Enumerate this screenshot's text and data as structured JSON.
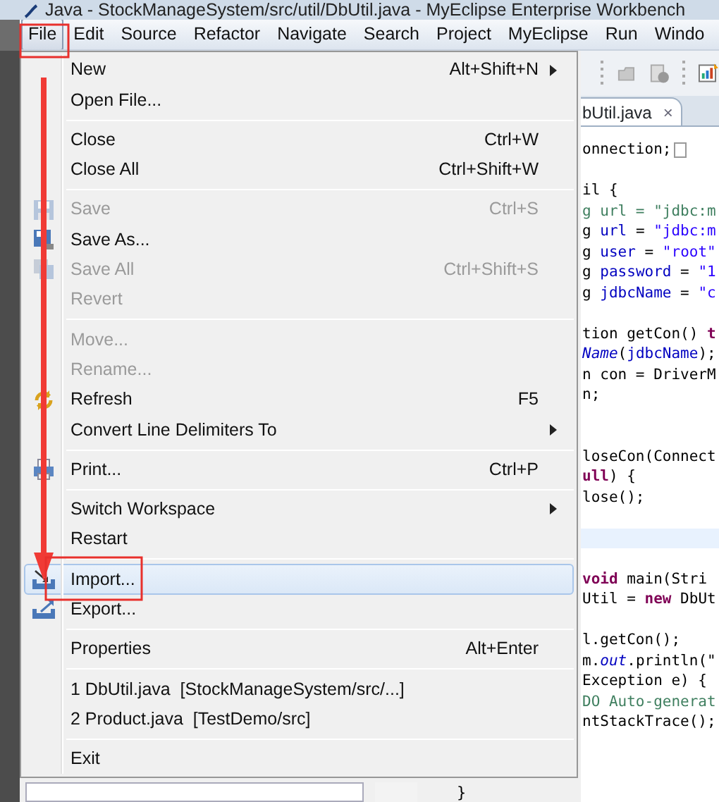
{
  "window": {
    "title": "Java - StockManageSystem/src/util/DbUtil.java - MyEclipse Enterprise Workbench"
  },
  "menubar": [
    {
      "label": "File",
      "selected": true
    },
    {
      "label": "Edit",
      "selected": false
    },
    {
      "label": "Source",
      "selected": false
    },
    {
      "label": "Refactor",
      "selected": false
    },
    {
      "label": "Navigate",
      "selected": false
    },
    {
      "label": "Search",
      "selected": false
    },
    {
      "label": "Project",
      "selected": false
    },
    {
      "label": "MyEclipse",
      "selected": false
    },
    {
      "label": "Run",
      "selected": false
    },
    {
      "label": "Windo",
      "selected": false
    }
  ],
  "file_menu": [
    {
      "kind": "item",
      "label": "New",
      "shortcut": "Alt+Shift+N",
      "submenu": true,
      "enabled": true,
      "selected": false
    },
    {
      "kind": "item",
      "label": "Open File...",
      "enabled": true,
      "selected": false
    },
    {
      "kind": "separator"
    },
    {
      "kind": "item",
      "label": "Close",
      "shortcut": "Ctrl+W",
      "enabled": true,
      "selected": false
    },
    {
      "kind": "item",
      "label": "Close All",
      "shortcut": "Ctrl+Shift+W",
      "enabled": true,
      "selected": false
    },
    {
      "kind": "separator"
    },
    {
      "kind": "item",
      "label": "Save",
      "shortcut": "Ctrl+S",
      "enabled": false,
      "selected": false,
      "icon": true
    },
    {
      "kind": "item",
      "label": "Save As...",
      "enabled": true,
      "selected": false,
      "icon": true
    },
    {
      "kind": "item",
      "label": "Save All",
      "shortcut": "Ctrl+Shift+S",
      "enabled": false,
      "selected": false,
      "icon": true
    },
    {
      "kind": "item",
      "label": "Revert",
      "enabled": false,
      "selected": false
    },
    {
      "kind": "separator"
    },
    {
      "kind": "item",
      "label": "Move...",
      "enabled": false,
      "selected": false
    },
    {
      "kind": "item",
      "label": "Rename...",
      "enabled": false,
      "selected": false
    },
    {
      "kind": "item",
      "label": "Refresh",
      "shortcut": "F5",
      "enabled": true,
      "selected": false,
      "icon": true
    },
    {
      "kind": "item",
      "label": "Convert Line Delimiters To",
      "submenu": true,
      "enabled": true,
      "selected": false
    },
    {
      "kind": "separator"
    },
    {
      "kind": "item",
      "label": "Print...",
      "shortcut": "Ctrl+P",
      "enabled": true,
      "selected": false,
      "icon": true
    },
    {
      "kind": "separator"
    },
    {
      "kind": "item",
      "label": "Switch Workspace",
      "submenu": true,
      "enabled": true,
      "selected": false
    },
    {
      "kind": "item",
      "label": "Restart",
      "enabled": true,
      "selected": false
    },
    {
      "kind": "separator"
    },
    {
      "kind": "item",
      "label": "Import...",
      "enabled": true,
      "selected": true,
      "icon": true
    },
    {
      "kind": "item",
      "label": "Export...",
      "enabled": true,
      "selected": false,
      "icon": true
    },
    {
      "kind": "separator"
    },
    {
      "kind": "item",
      "label": "Properties",
      "shortcut": "Alt+Enter",
      "enabled": true,
      "selected": false
    },
    {
      "kind": "separator"
    },
    {
      "kind": "item",
      "label": "1 DbUtil.java  [StockManageSystem/src/...]",
      "enabled": true,
      "selected": false
    },
    {
      "kind": "item",
      "label": "2 Product.java  [TestDemo/src]",
      "enabled": true,
      "selected": false
    },
    {
      "kind": "separator"
    },
    {
      "kind": "item",
      "label": "Exit",
      "enabled": true,
      "selected": false
    }
  ],
  "editor": {
    "tab": {
      "label": "bUtil.java",
      "close": "×"
    },
    "lines": [
      {
        "segments": [
          {
            "text": "onnection;",
            "kind": "plain"
          }
        ],
        "folded": true
      },
      {
        "kind": "blank"
      },
      {
        "segments": [
          {
            "text": "il {",
            "kind": "plain"
          }
        ]
      },
      {
        "segments": [
          {
            "text": "g url = \"jdbc:m",
            "kind": "comment"
          }
        ]
      },
      {
        "segments": [
          {
            "text": "g ",
            "kind": "plain"
          },
          {
            "text": "url",
            "kind": "field"
          },
          {
            "text": " = ",
            "kind": "plain"
          },
          {
            "text": "\"jdbc:m",
            "kind": "string"
          }
        ]
      },
      {
        "segments": [
          {
            "text": "g ",
            "kind": "plain"
          },
          {
            "text": "user",
            "kind": "field"
          },
          {
            "text": " = ",
            "kind": "plain"
          },
          {
            "text": "\"root\"",
            "kind": "string"
          }
        ]
      },
      {
        "segments": [
          {
            "text": "g ",
            "kind": "plain"
          },
          {
            "text": "password",
            "kind": "field"
          },
          {
            "text": " = ",
            "kind": "plain"
          },
          {
            "text": "\"1",
            "kind": "string"
          }
        ]
      },
      {
        "segments": [
          {
            "text": "g ",
            "kind": "plain"
          },
          {
            "text": "jdbcName",
            "kind": "field"
          },
          {
            "text": " = ",
            "kind": "plain"
          },
          {
            "text": "\"c",
            "kind": "string"
          }
        ]
      },
      {
        "kind": "blank"
      },
      {
        "segments": [
          {
            "text": "tion getCon() ",
            "kind": "plain"
          },
          {
            "text": "t",
            "kind": "keyword"
          }
        ]
      },
      {
        "segments": [
          {
            "text": "Name",
            "kind": "static"
          },
          {
            "text": "(",
            "kind": "plain"
          },
          {
            "text": "jdbcName",
            "kind": "field"
          },
          {
            "text": ");",
            "kind": "plain"
          }
        ]
      },
      {
        "segments": [
          {
            "text": "n con = DriverM",
            "kind": "plain"
          }
        ]
      },
      {
        "segments": [
          {
            "text": "n;",
            "kind": "plain"
          }
        ]
      },
      {
        "kind": "blank"
      },
      {
        "kind": "blank"
      },
      {
        "segments": [
          {
            "text": "loseCon(Connect",
            "kind": "plain"
          }
        ]
      },
      {
        "segments": [
          {
            "text": "ull",
            "kind": "keyword"
          },
          {
            "text": ") {",
            "kind": "plain"
          }
        ]
      },
      {
        "segments": [
          {
            "text": "lose();",
            "kind": "plain"
          }
        ]
      },
      {
        "kind": "blank"
      },
      {
        "kind": "blank",
        "current": true
      },
      {
        "kind": "blank"
      },
      {
        "segments": [
          {
            "text": "void",
            "kind": "keyword"
          },
          {
            "text": " main(Stri",
            "kind": "plain"
          }
        ]
      },
      {
        "segments": [
          {
            "text": "Util = ",
            "kind": "plain"
          },
          {
            "text": "new",
            "kind": "keyword"
          },
          {
            "text": " DbUt",
            "kind": "plain"
          }
        ]
      },
      {
        "kind": "blank"
      },
      {
        "segments": [
          {
            "text": "l.getCon();",
            "kind": "plain"
          }
        ]
      },
      {
        "segments": [
          {
            "text": "m.",
            "kind": "plain"
          },
          {
            "text": "out",
            "kind": "static"
          },
          {
            "text": ".println(\"",
            "kind": "plain"
          }
        ]
      },
      {
        "segments": [
          {
            "text": "Exception e) {",
            "kind": "plain"
          }
        ]
      },
      {
        "segments": [
          {
            "text": "DO Auto-generat",
            "kind": "comment"
          }
        ]
      },
      {
        "segments": [
          {
            "text": "ntStackTrace();",
            "kind": "plain"
          }
        ]
      }
    ],
    "below_menu_text": "}"
  }
}
